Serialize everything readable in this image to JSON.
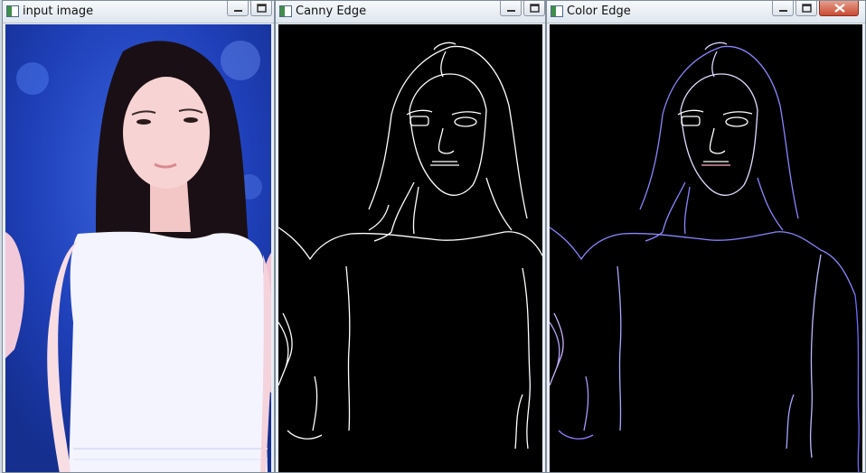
{
  "windows": [
    {
      "title": "input image",
      "buttons": [
        "minimize-icon",
        "maximize-icon"
      ]
    },
    {
      "title": "Canny Edge",
      "buttons": [
        "minimize-icon",
        "maximize-icon"
      ]
    },
    {
      "title": "Color Edge",
      "buttons": [
        "minimize-icon",
        "maximize-icon",
        "close-icon"
      ]
    }
  ],
  "colors": {
    "edge_white": "#ffffff",
    "edge_blue": "#8a86ff",
    "dress": "#f3f4ff",
    "background_blue": "#1f47c4"
  }
}
